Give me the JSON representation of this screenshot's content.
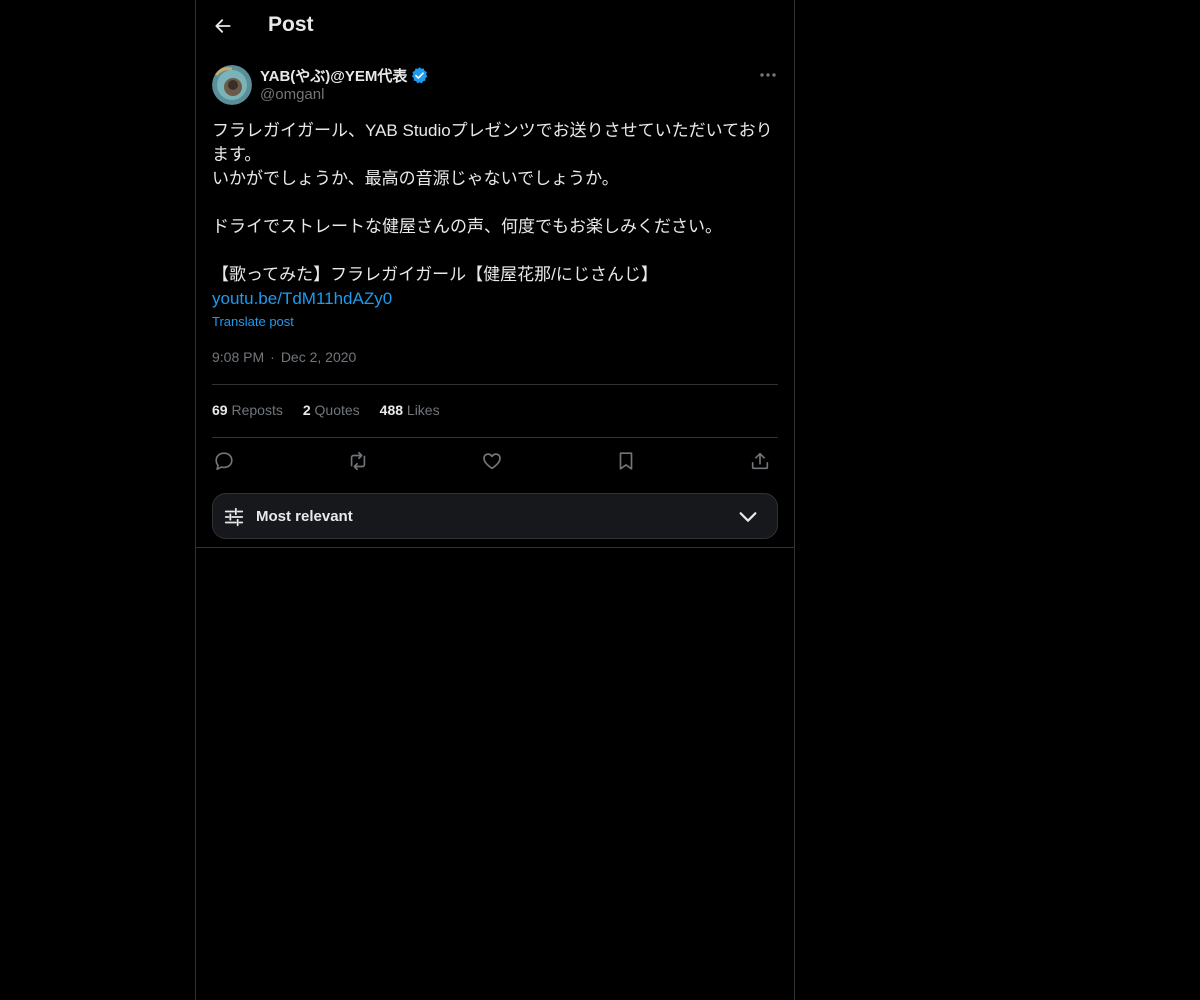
{
  "header": {
    "title": "Post"
  },
  "post": {
    "author_name": "YAB(やぶ)@YEM代表",
    "author_handle": "@omganl",
    "text": "フラレガイガール、YAB Studioプレゼンツでお送りさせていただいております。\nいかがでしょうか、最高の音源じゃないでしょうか。\n\nドライでストレートな健屋さんの声、何度でもお楽しみください。\n\n【歌ってみた】フラレガイガール【健屋花那/にじさんじ】",
    "link": "youtu.be/TdM11hdAZy0",
    "translate_label": "Translate post",
    "time": "9:08 PM",
    "separator": "·",
    "date": "Dec 2, 2020"
  },
  "stats": {
    "reposts_count": "69",
    "reposts_label": "Reposts",
    "quotes_count": "2",
    "quotes_label": "Quotes",
    "likes_count": "488",
    "likes_label": "Likes"
  },
  "sort": {
    "label": "Most relevant"
  },
  "icons": {
    "back": "arrow-left-icon",
    "verified": "verified-badge-icon",
    "more": "more-horizontal-icon",
    "reply": "reply-icon",
    "repost": "repost-icon",
    "like": "heart-icon",
    "bookmark": "bookmark-icon",
    "share": "share-icon",
    "sort": "sliders-icon",
    "expand": "chevron-down-icon"
  },
  "colors": {
    "background": "#000000",
    "text": "#e7e9ea",
    "secondary": "#71767b",
    "accent": "#1d9bf0",
    "border": "#2f3336"
  }
}
